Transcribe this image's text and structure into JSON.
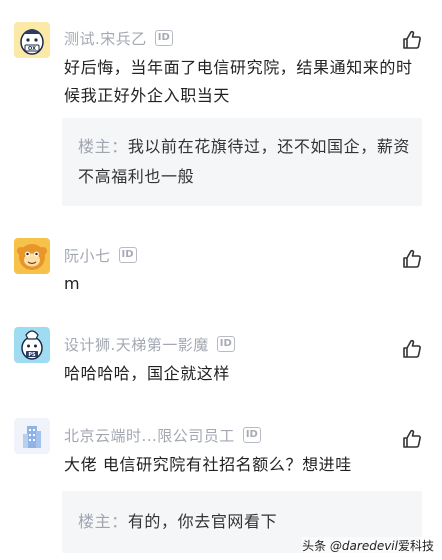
{
  "comments": [
    {
      "name": "测试.宋兵乙",
      "badge": "ID",
      "avatar_icon": "ox-mask-avatar",
      "text": "好后悔，当年面了电信研究院，结果通知来的时候我正好外企入职当天",
      "reply": {
        "owner": "楼主：",
        "text": "我以前在花旗待过，还不如国企，薪资不高福利也一般"
      }
    },
    {
      "name": "阮小七",
      "badge": "ID",
      "avatar_icon": "orange-monkey-avatar",
      "text": "m"
    },
    {
      "name": "设计狮.天梯第一影魔",
      "badge": "ID",
      "avatar_icon": "ps-mask-avatar",
      "text": "哈哈哈哈，国企就这样"
    },
    {
      "name": "北京云端时...限公司员工",
      "badge": "ID",
      "avatar_icon": "building-avatar",
      "text": "大佬 电信研究院有社招名额么？想进哇",
      "reply": {
        "owner": "楼主：",
        "text": "有的，你去官网看下"
      }
    }
  ],
  "watermark": {
    "prefix": "头条 ",
    "handle": "@daredevil",
    "suffix": "爱科技"
  },
  "colors": {
    "name": "#a3a8b2",
    "text": "#222222",
    "reply_bg": "#f5f6f8"
  }
}
